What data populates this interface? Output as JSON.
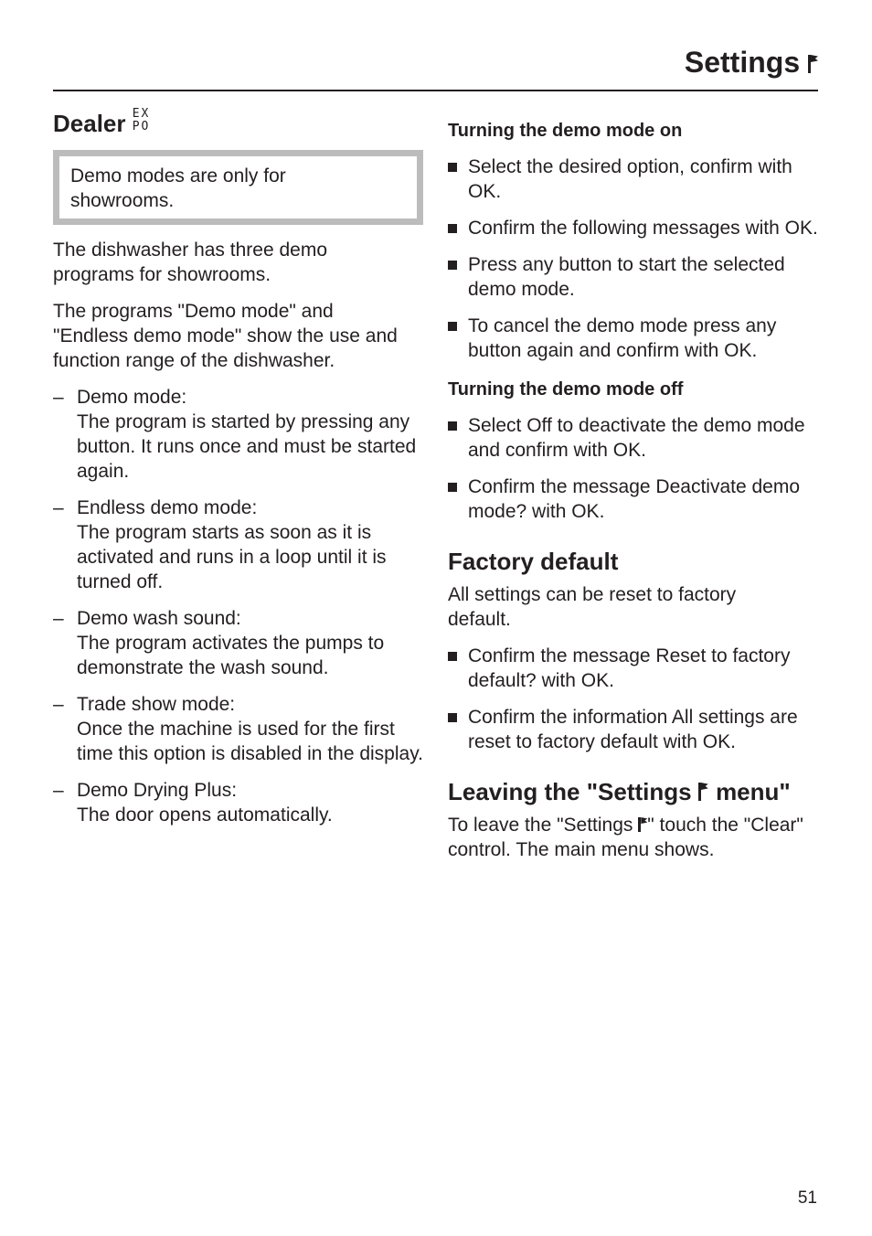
{
  "header": {
    "title": "Settings",
    "icon": "flag-icon"
  },
  "left": {
    "heading": "Dealer",
    "heading_icon_top": "EX",
    "heading_icon_bottom": "PO",
    "note": "Demo modes are  only for showrooms.",
    "para1": "The dishwasher has three demo programs for showrooms.",
    "para2": "The programs \"Demo mode\" and \"Endless demo mode\" show the use and function range of the dishwasher.",
    "dash": "–",
    "items": [
      {
        "title": "Demo mode:",
        "text": "The program is started by pressing any button. It runs once and must be started again."
      },
      {
        "title": "Endless demo mode:",
        "text": "The program starts as soon as it is activated and runs in a loop until it is turned off."
      },
      {
        "title": "Demo wash sound:",
        "text": "The program activates the pumps to demonstrate the wash sound."
      },
      {
        "title": "Trade show mode:",
        "text": "Once the machine is used for the first time this option is disabled in the display."
      },
      {
        "title": "Demo Drying Plus:",
        "text": "The door opens automatically."
      }
    ]
  },
  "right": {
    "demo_on": {
      "heading": "Turning the demo mode on",
      "steps": [
        "Select the desired option, confirm with OK.",
        "Confirm the following messages with OK.",
        "Press any button to start the selected demo mode.",
        "To cancel the demo mode press any button again and confirm with OK."
      ]
    },
    "demo_off": {
      "heading": "Turning the demo mode off",
      "steps": [
        "Select Off to deactivate the demo mode and confirm with OK.",
        "Confirm the message Deactivate demo mode? with OK."
      ]
    },
    "factory": {
      "heading": "Factory default",
      "intro": "All settings can be reset to factory default.",
      "steps": [
        "Confirm the message Reset to factory default? with OK.",
        "Confirm the information All settings are reset to factory default with OK."
      ]
    },
    "leaving": {
      "heading_pre": "Leaving the \"Settings",
      "heading_post": "menu\"",
      "text_pre": "To leave the \"Settings",
      "text_post": "\" touch the \"Clear\" control. The main menu shows."
    }
  },
  "footer": {
    "page_number": "51"
  }
}
